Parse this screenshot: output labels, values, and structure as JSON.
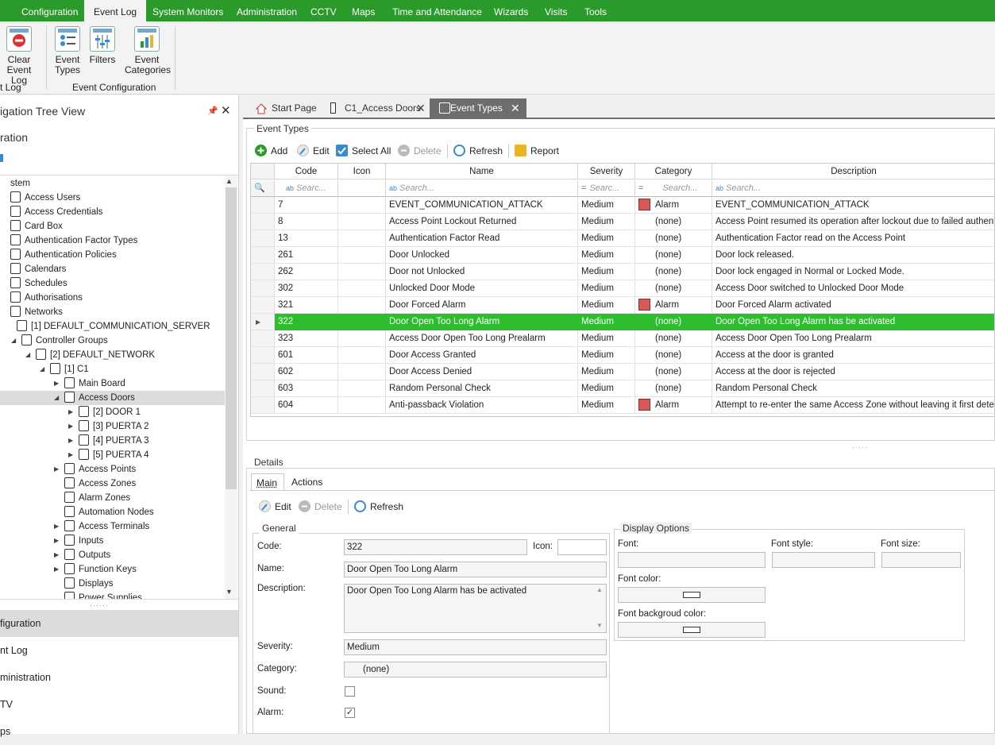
{
  "menu": {
    "items": [
      "Configuration",
      "Event Log",
      "System Monitors",
      "Administration",
      "CCTV",
      "Maps",
      "Time and Attendance",
      "Wizards",
      "Visits",
      "Tools"
    ],
    "active": "Event Log"
  },
  "ribbon": {
    "clear_label_1": "Clear",
    "clear_label_2": "Event Log",
    "event_types_1": "Event",
    "event_types_2": "Types",
    "filters": "Filters",
    "event_categories_1": "Event",
    "event_categories_2": "Categories",
    "group_log": "t Log",
    "group_config": "Event Configuration"
  },
  "left": {
    "title": "igation Tree View",
    "subtitle": "ration",
    "tree": [
      {
        "label": "stem",
        "level": 0,
        "exp": ""
      },
      {
        "label": "Access Users",
        "level": 0,
        "exp": ""
      },
      {
        "label": "Access Credentials",
        "level": 0,
        "exp": ""
      },
      {
        "label": "Card Box",
        "level": 0,
        "exp": ""
      },
      {
        "label": "Authentication Factor Types",
        "level": 0,
        "exp": ""
      },
      {
        "label": "Authentication Policies",
        "level": 0,
        "exp": ""
      },
      {
        "label": "Calendars",
        "level": 0,
        "exp": ""
      },
      {
        "label": "Schedules",
        "level": 0,
        "exp": ""
      },
      {
        "label": "Authorisations",
        "level": 0,
        "exp": ""
      },
      {
        "label": "Networks",
        "level": 0,
        "exp": ""
      },
      {
        "label": "[1] DEFAULT_COMMUNICATION_SERVER",
        "level": 1,
        "exp": ""
      },
      {
        "label": "Controller Groups",
        "level": 2,
        "exp": "◢"
      },
      {
        "label": "[2] DEFAULT_NETWORK",
        "level": 3,
        "exp": "◢"
      },
      {
        "label": "[1] C1",
        "level": 4,
        "exp": "◢"
      },
      {
        "label": "Main Board",
        "level": 5,
        "exp": "▶"
      },
      {
        "label": "Access Doors",
        "level": 5,
        "exp": "◢"
      },
      {
        "label": "[2] DOOR 1",
        "level": 6,
        "exp": "▶"
      },
      {
        "label": "[3] PUERTA 2",
        "level": 6,
        "exp": "▶"
      },
      {
        "label": "[4] PUERTA 3",
        "level": 6,
        "exp": "▶"
      },
      {
        "label": "[5] PUERTA 4",
        "level": 6,
        "exp": "▶"
      },
      {
        "label": "Access Points",
        "level": 5,
        "exp": "▶"
      },
      {
        "label": "Access Zones",
        "level": 5,
        "exp": ""
      },
      {
        "label": "Alarm Zones",
        "level": 5,
        "exp": ""
      },
      {
        "label": "Automation Nodes",
        "level": 5,
        "exp": ""
      },
      {
        "label": "Access Terminals",
        "level": 5,
        "exp": "▶"
      },
      {
        "label": "Inputs",
        "level": 5,
        "exp": "▶"
      },
      {
        "label": "Outputs",
        "level": 5,
        "exp": "▶"
      },
      {
        "label": "Function Keys",
        "level": 5,
        "exp": "▶"
      },
      {
        "label": "Displays",
        "level": 5,
        "exp": ""
      },
      {
        "label": "Power Supplies",
        "level": 5,
        "exp": ""
      }
    ],
    "selected": "Access Doors",
    "nav": [
      "figuration",
      "nt Log",
      "ministration",
      "TV",
      "ps"
    ]
  },
  "tabs": [
    {
      "label": "Start Page",
      "active": false
    },
    {
      "label": "C1_Access Doors",
      "active": false
    },
    {
      "label": "Event Types",
      "active": true
    }
  ],
  "event_types": {
    "title": "Event Types",
    "toolbar": {
      "add": "Add",
      "edit": "Edit",
      "select_all": "Select All",
      "delete": "Delete",
      "refresh": "Refresh",
      "report": "Report"
    },
    "columns": [
      "Code",
      "Icon",
      "Name",
      "Severity",
      "Category",
      "Description"
    ],
    "filter_placeholder": "Search...",
    "filter_short": "Searc...",
    "filter_code": "Searc",
    "rows": [
      {
        "code": "7",
        "name": "EVENT_COMMUNICATION_ATTACK",
        "severity": "Medium",
        "category": "Alarm",
        "alarm": true,
        "description": "EVENT_COMMUNICATION_ATTACK"
      },
      {
        "code": "8",
        "name": "Access Point Lockout Returned",
        "severity": "Medium",
        "category": "(none)",
        "alarm": false,
        "description": "Access Point resumed its operation after lockout due to failed authenticat"
      },
      {
        "code": "13",
        "name": "Authentication Factor Read",
        "severity": "Medium",
        "category": "(none)",
        "alarm": false,
        "description": "Authentication Factor read on the Access Point"
      },
      {
        "code": "261",
        "name": "Door Unlocked",
        "severity": "Medium",
        "category": "(none)",
        "alarm": false,
        "description": "Door lock released."
      },
      {
        "code": "262",
        "name": "Door not Unlocked",
        "severity": "Medium",
        "category": "(none)",
        "alarm": false,
        "description": "Door lock engaged in Normal or Locked Mode."
      },
      {
        "code": "302",
        "name": "Unlocked Door Mode",
        "severity": "Medium",
        "category": "(none)",
        "alarm": false,
        "description": "Access Door switched to Unlocked Door Mode"
      },
      {
        "code": "321",
        "name": "Door Forced Alarm",
        "severity": "Medium",
        "category": "Alarm",
        "alarm": true,
        "description": "Door Forced Alarm activated"
      },
      {
        "code": "322",
        "name": "Door Open Too Long Alarm",
        "severity": "Medium",
        "category": "(none)",
        "alarm": false,
        "description": "Door Open Too Long Alarm has be activated",
        "selected": true
      },
      {
        "code": "323",
        "name": "Access Door Open Too Long Prealarm",
        "severity": "Medium",
        "category": "(none)",
        "alarm": false,
        "description": "Access Door Open Too Long Prealarm"
      },
      {
        "code": "601",
        "name": "Door Access Granted",
        "severity": "Medium",
        "category": "(none)",
        "alarm": false,
        "description": "Access at the door is granted"
      },
      {
        "code": "602",
        "name": "Door Access Denied",
        "severity": "Medium",
        "category": "(none)",
        "alarm": false,
        "description": "Access at the door is rejected"
      },
      {
        "code": "603",
        "name": "Random Personal Check",
        "severity": "Medium",
        "category": "(none)",
        "alarm": false,
        "description": "Random Personal Check"
      },
      {
        "code": "604",
        "name": "Anti-passback Violation",
        "severity": "Medium",
        "category": "Alarm",
        "alarm": true,
        "description": "Attempt to re-enter the same Access Zone without leaving it first detecte"
      }
    ]
  },
  "details": {
    "title": "Details",
    "tabs": [
      "Main",
      "Actions"
    ],
    "toolbar": {
      "edit": "Edit",
      "delete": "Delete",
      "refresh": "Refresh"
    },
    "general_title": "General",
    "labels": {
      "code": "Code:",
      "icon": "Icon:",
      "name": "Name:",
      "description": "Description:",
      "severity": "Severity:",
      "category": "Category:",
      "sound": "Sound:",
      "alarm": "Alarm:"
    },
    "values": {
      "code": "322",
      "name": "Door Open Too Long Alarm",
      "description": "Door Open Too Long Alarm has be activated",
      "severity": "Medium",
      "category": "(none)",
      "sound": false,
      "alarm": true
    },
    "display_title": "Display Options",
    "display_labels": {
      "font": "Font:",
      "font_style": "Font style:",
      "font_size": "Font size:",
      "font_color": "Font color:",
      "font_bg": "Font backgroud color:"
    }
  },
  "colors": {
    "accent": "#2a9a2a",
    "selected_row": "#2ebd2e",
    "alarm_swatch": "#d45a5a"
  }
}
